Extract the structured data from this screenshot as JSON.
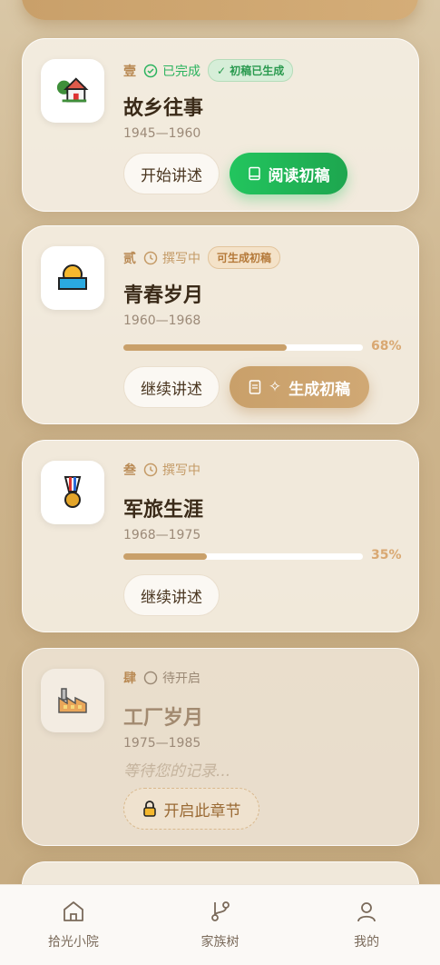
{
  "banner": {
    "label": ""
  },
  "chapters": [
    {
      "num": "壹",
      "status": "已完成",
      "badge": "初稿已生成",
      "title": "故乡往事",
      "years": "1945—1960",
      "btn1": "开始讲述",
      "btn2": "阅读初稿"
    },
    {
      "num": "贰",
      "status": "撰写中",
      "badge": "可生成初稿",
      "title": "青春岁月",
      "years": "1960—1968",
      "progress": "68%",
      "progress_value": 68,
      "btn1": "继续讲述",
      "btn2": "生成初稿"
    },
    {
      "num": "叁",
      "status": "撰写中",
      "title": "军旅生涯",
      "years": "1968—1975",
      "progress": "35%",
      "progress_value": 35,
      "btn1": "继续讲述"
    },
    {
      "num": "肆",
      "status": "待开启",
      "title": "工厂岁月",
      "years": "1975—1985",
      "waiting": "等待您的记录...",
      "btn1": "开启此章节"
    }
  ],
  "tabs": [
    {
      "label": "拾光小院",
      "icon": "home-icon"
    },
    {
      "label": "家族树",
      "icon": "branch-icon"
    },
    {
      "label": "我的",
      "icon": "user-icon"
    }
  ],
  "colors": {
    "accent": "#c9a06a",
    "green": "#22c55e"
  }
}
